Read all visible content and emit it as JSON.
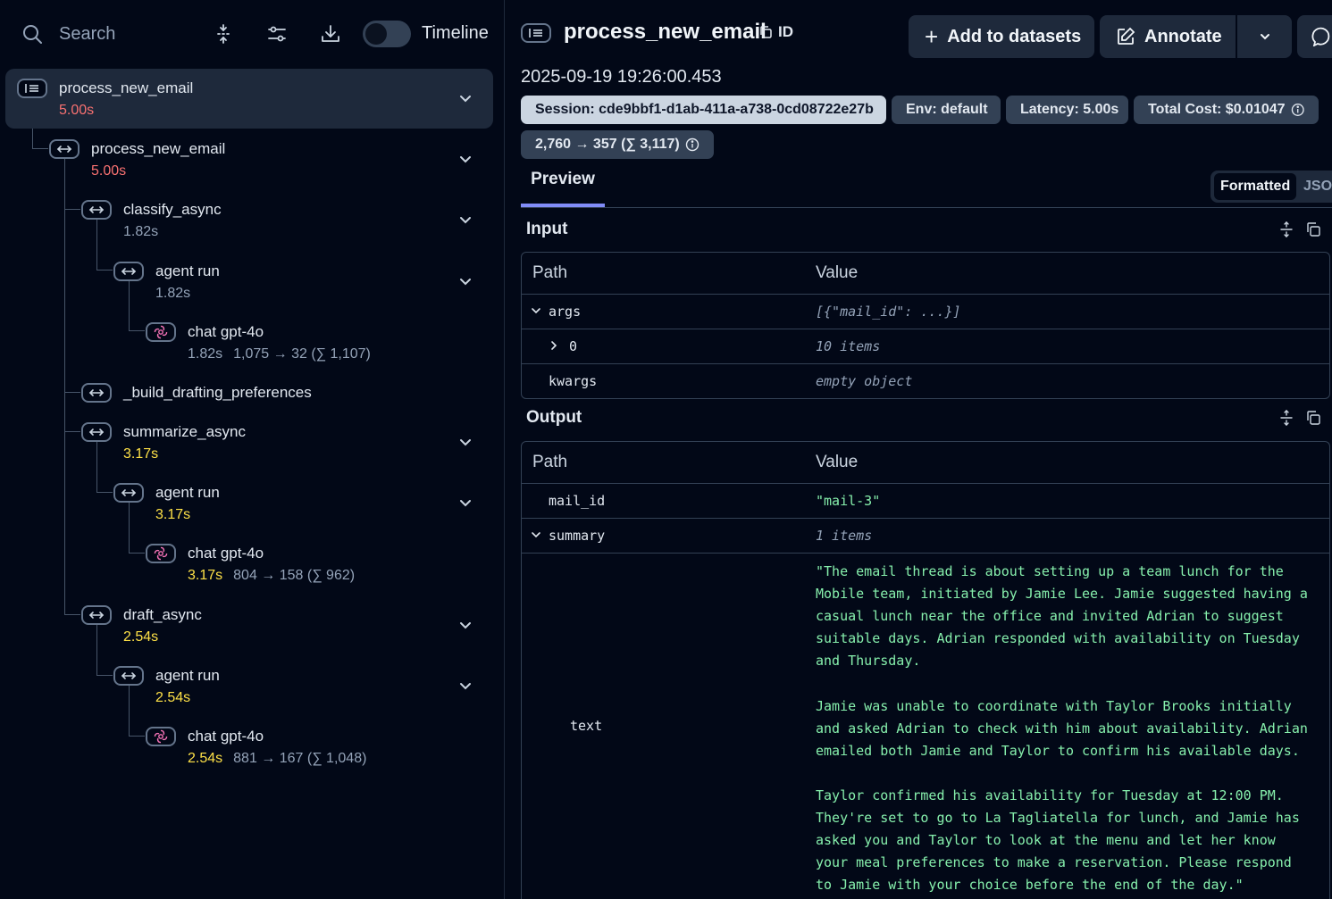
{
  "left": {
    "search_label": "Search",
    "timeline_label": "Timeline",
    "timeline_on": false,
    "nodes": [
      {
        "name": "process_new_email",
        "latency": "5.00s",
        "tokens": "",
        "icon": "list-icon"
      },
      {
        "name": "process_new_email",
        "latency": "5.00s",
        "tokens": "",
        "icon": "arrows-icon"
      },
      {
        "name": "classify_async",
        "latency": "1.82s",
        "tokens": "",
        "icon": "arrows-icon"
      },
      {
        "name": "agent run",
        "latency": "1.82s",
        "tokens": "",
        "icon": "arrows-icon"
      },
      {
        "name": "chat gpt-4o",
        "latency": "1.82s",
        "tokens": "1,075 → 32 (∑ 1,107)",
        "icon": "openai-icon"
      },
      {
        "name": "_build_drafting_preferences",
        "latency": "",
        "tokens": "",
        "icon": "arrows-icon"
      },
      {
        "name": "summarize_async",
        "latency": "3.17s",
        "tokens": "",
        "icon": "arrows-icon"
      },
      {
        "name": "agent run",
        "latency": "3.17s",
        "tokens": "",
        "icon": "arrows-icon"
      },
      {
        "name": "chat gpt-4o",
        "latency": "3.17s",
        "tokens": "804 → 158 (∑ 962)",
        "icon": "openai-icon"
      },
      {
        "name": "draft_async",
        "latency": "2.54s",
        "tokens": "",
        "icon": "arrows-icon"
      },
      {
        "name": "agent run",
        "latency": "2.54s",
        "tokens": "",
        "icon": "arrows-icon"
      },
      {
        "name": "chat gpt-4o",
        "latency": "2.54s",
        "tokens": "881 → 167 (∑ 1,048)",
        "icon": "openai-icon"
      }
    ]
  },
  "right": {
    "title": "process_new_email",
    "id_label": "ID",
    "add_to_datasets": "Add to datasets",
    "annotate": "Annotate",
    "timestamp": "2025-09-19 19:26:00.453",
    "pills": {
      "session": "Session: cde9bbf1-d1ab-411a-a738-0cd08722e27b",
      "env": "Env: default",
      "latency": "Latency: 5.00s",
      "cost": "Total Cost: $0.01047",
      "tokens": "2,760 → 357 (∑ 3,117)"
    },
    "tab_preview": "Preview",
    "seg_formatted": "Formatted",
    "seg_json": "JSON",
    "input": {
      "title": "Input",
      "col_path": "Path",
      "col_value": "Value",
      "rows": [
        {
          "key": "args",
          "value": "[{\"mail_id\": ...}]"
        },
        {
          "key": "0",
          "value": "10 items"
        },
        {
          "key": "kwargs",
          "value": "empty object"
        }
      ]
    },
    "output": {
      "title": "Output",
      "col_path": "Path",
      "col_value": "Value",
      "rows": [
        {
          "key": "mail_id",
          "value": "\"mail-3\""
        },
        {
          "key": "summary",
          "value": "1 items"
        },
        {
          "key": "text",
          "value": "\"The email thread is about setting up a team lunch for the\nMobile team, initiated by Jamie Lee. Jamie suggested having a\ncasual lunch near the office and invited Adrian to suggest\nsuitable days. Adrian responded with availability on Tuesday\nand Thursday.\n\nJamie was unable to coordinate with Taylor Brooks initially\nand asked Adrian to check with him about availability. Adrian\nemailed both Jamie and Taylor to confirm his available days.\n\nTaylor confirmed his availability for Tuesday at 12:00 PM.\nThey're set to go to La Tagliatella for lunch, and Jamie has\nasked you and Taylor to look at the menu and let her know\nyour meal preferences to make a reservation. Please respond\nto Jamie with your choice before the end of the day.\""
        }
      ]
    }
  }
}
